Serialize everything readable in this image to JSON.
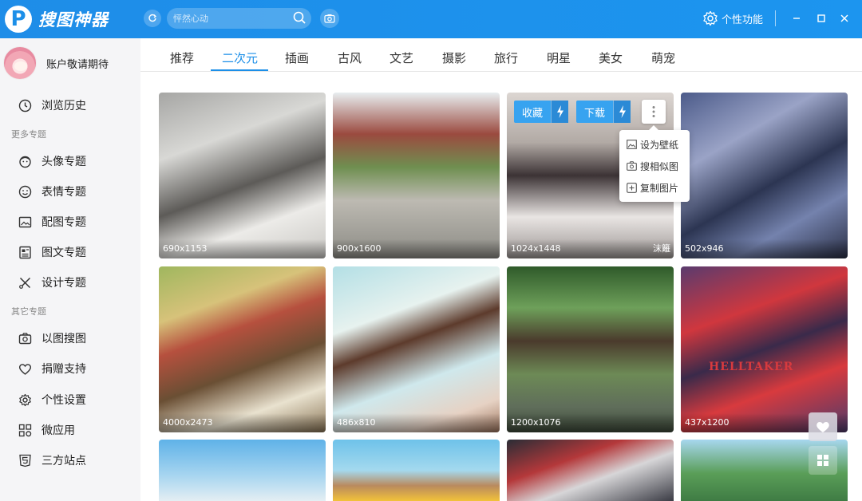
{
  "app": {
    "logo_letter": "P",
    "title": "搜图神器",
    "search_placeholder": "怦然心动",
    "personal_label": "个性功能"
  },
  "sidebar": {
    "username": "账户敬请期待",
    "history": "浏览历史",
    "section_more": "更多专题",
    "topics": [
      "头像专题",
      "表情专题",
      "配图专题",
      "图文专题",
      "设计专题"
    ],
    "section_other": "其它专题",
    "others": [
      "以图搜图",
      "捐赠支持",
      "个性设置",
      "微应用",
      "三方站点"
    ]
  },
  "tabs": [
    "推荐",
    "二次元",
    "插画",
    "古风",
    "文艺",
    "摄影",
    "旅行",
    "明星",
    "美女",
    "萌宠"
  ],
  "active_tab": "二次元",
  "images": [
    {
      "dims": "690x1153"
    },
    {
      "dims": "900x1600"
    },
    {
      "dims": "1024x1448",
      "mark": "沫籬"
    },
    {
      "dims": "502x946"
    },
    {
      "dims": "4000x2473"
    },
    {
      "dims": "486x810"
    },
    {
      "dims": "1200x1076"
    },
    {
      "dims": "437x1200",
      "title": "HELLTAKER"
    }
  ],
  "overlay": {
    "collect": "收藏",
    "download": "下载",
    "menu": [
      "设为壁纸",
      "搜相似图",
      "复制图片"
    ]
  },
  "colors": {
    "primary": "#1c8fe8",
    "sidebar_bg": "#f5f5f7"
  }
}
